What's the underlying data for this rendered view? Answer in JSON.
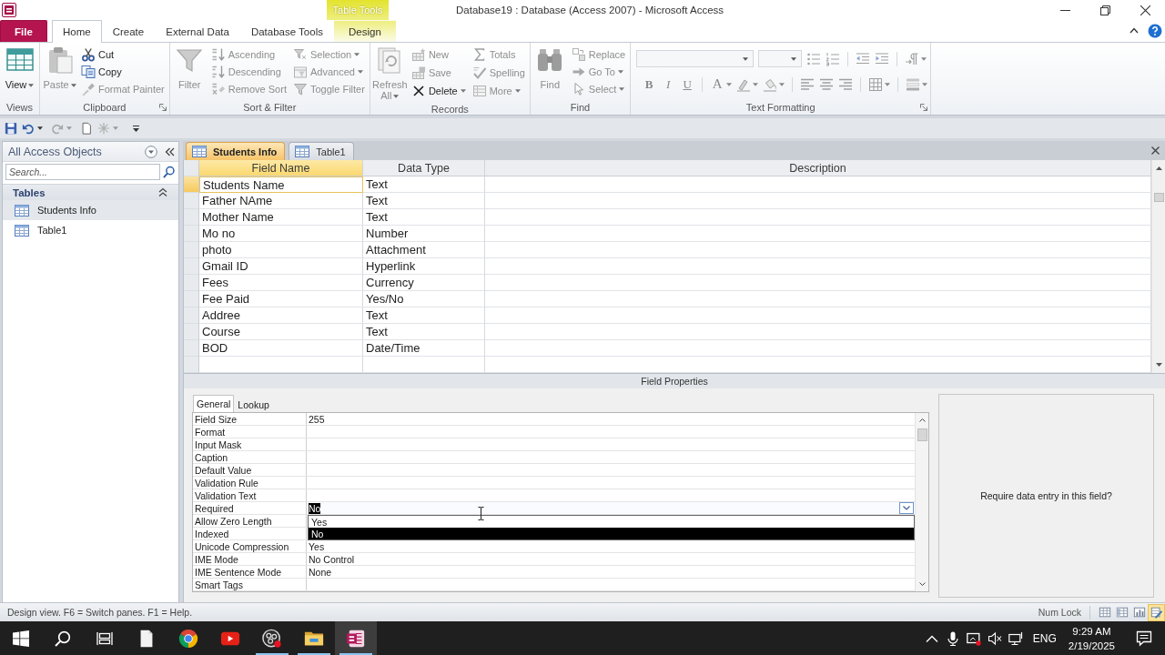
{
  "title_bar": {
    "contextual_group": "Table Tools",
    "title": "Database19 : Database (Access 2007) - Microsoft Access"
  },
  "ribbon_tabs": [
    {
      "label": "File",
      "kind": "backstage",
      "selected": false
    },
    {
      "label": "Home",
      "kind": "standard",
      "selected": true
    },
    {
      "label": "Create",
      "kind": "standard",
      "selected": false
    },
    {
      "label": "External Data",
      "kind": "standard",
      "selected": false
    },
    {
      "label": "Database Tools",
      "kind": "standard",
      "selected": false
    },
    {
      "label": "Design",
      "kind": "contextual",
      "selected": false
    }
  ],
  "ribbon_groups": [
    {
      "label": "Views",
      "kind": "commands",
      "launcher": false,
      "columns": [
        [
          {
            "label": "View",
            "kind": "large",
            "disabled": false,
            "dropdown": true
          }
        ]
      ]
    },
    {
      "label": "Clipboard",
      "kind": "commands",
      "launcher": true,
      "columns": [
        [
          {
            "label": "Paste",
            "kind": "large",
            "disabled": true,
            "dropdown": true
          }
        ],
        [
          {
            "label": "Cut",
            "kind": "small",
            "disabled": false,
            "dropdown": false
          },
          {
            "label": "Copy",
            "kind": "small",
            "disabled": false,
            "dropdown": false
          },
          {
            "label": "Format Painter",
            "kind": "small",
            "disabled": true,
            "dropdown": false
          }
        ]
      ]
    },
    {
      "label": "Sort & Filter",
      "kind": "commands",
      "launcher": false,
      "columns": [
        [
          {
            "label": "Filter",
            "kind": "large",
            "disabled": true,
            "dropdown": false
          }
        ],
        [
          {
            "label": "Ascending",
            "kind": "small",
            "disabled": true,
            "dropdown": false
          },
          {
            "label": "Descending",
            "kind": "small",
            "disabled": true,
            "dropdown": false
          },
          {
            "label": "Remove Sort",
            "kind": "small",
            "disabled": true,
            "dropdown": false
          }
        ],
        [
          {
            "label": "Selection",
            "kind": "small",
            "disabled": true,
            "dropdown": true
          },
          {
            "label": "Advanced",
            "kind": "small",
            "disabled": true,
            "dropdown": true
          },
          {
            "label": "Toggle Filter",
            "kind": "small",
            "disabled": true,
            "dropdown": false
          }
        ]
      ]
    },
    {
      "label": "Records",
      "kind": "commands",
      "launcher": false,
      "columns": [
        [
          {
            "label": "Refresh All",
            "kind": "large",
            "disabled": true,
            "dropdown": true
          }
        ],
        [
          {
            "label": "New",
            "kind": "small",
            "disabled": true,
            "dropdown": false
          },
          {
            "label": "Save",
            "kind": "small",
            "disabled": true,
            "dropdown": false
          },
          {
            "label": "Delete",
            "kind": "small",
            "disabled": false,
            "dropdown": true
          }
        ],
        [
          {
            "label": "Totals",
            "kind": "small",
            "disabled": true,
            "dropdown": false
          },
          {
            "label": "Spelling",
            "kind": "small",
            "disabled": true,
            "dropdown": false
          },
          {
            "label": "More",
            "kind": "small",
            "disabled": true,
            "dropdown": true
          }
        ]
      ]
    },
    {
      "label": "Find",
      "kind": "commands",
      "launcher": false,
      "columns": [
        [
          {
            "label": "Find",
            "kind": "large",
            "disabled": true,
            "dropdown": false
          }
        ],
        [
          {
            "label": "Replace",
            "kind": "small",
            "disabled": true,
            "dropdown": false
          },
          {
            "label": "Go To",
            "kind": "small",
            "disabled": true,
            "dropdown": true
          },
          {
            "label": "Select",
            "kind": "small",
            "disabled": true,
            "dropdown": true
          }
        ]
      ]
    },
    {
      "label": "Text Formatting",
      "kind": "formatting",
      "launcher": true,
      "disabled": true,
      "glyphs": [
        "B",
        "I",
        "U",
        "A"
      ]
    }
  ],
  "navigation_pane": {
    "title": "All Access Objects",
    "search": {
      "placeholder": "Search..."
    },
    "groups": [
      {
        "label": "Tables",
        "expanded": true,
        "items": [
          {
            "label": "Students Info",
            "selected": true
          },
          {
            "label": "Table1",
            "selected": false
          }
        ]
      }
    ]
  },
  "document_tabs": [
    {
      "label": "Students Info",
      "selected": true
    },
    {
      "label": "Table1",
      "selected": false
    }
  ],
  "design_grid": {
    "columns": [
      {
        "label": "Field Name",
        "selected": true
      },
      {
        "label": "Data Type",
        "selected": false
      },
      {
        "label": "Description",
        "selected": false
      }
    ],
    "rows": [
      {
        "field_name": "Students Name",
        "data_type": "Text",
        "selected": true
      },
      {
        "field_name": "Father NAme",
        "data_type": "Text",
        "selected": false
      },
      {
        "field_name": "Mother Name",
        "data_type": "Text",
        "selected": false
      },
      {
        "field_name": "Mo no",
        "data_type": "Number",
        "selected": false
      },
      {
        "field_name": "photo",
        "data_type": "Attachment",
        "selected": false
      },
      {
        "field_name": "Gmail ID",
        "data_type": "Hyperlink",
        "selected": false
      },
      {
        "field_name": "Fees",
        "data_type": "Currency",
        "selected": false
      },
      {
        "field_name": "Fee Paid",
        "data_type": "Yes/No",
        "selected": false
      },
      {
        "field_name": "Addree",
        "data_type": "Text",
        "selected": false
      },
      {
        "field_name": "Course",
        "data_type": "Text",
        "selected": false
      },
      {
        "field_name": "BOD",
        "data_type": "Date/Time",
        "selected": false
      }
    ]
  },
  "field_properties": {
    "title": "Field Properties",
    "tabs": [
      {
        "label": "General",
        "selected": true
      },
      {
        "label": "Lookup",
        "selected": false
      }
    ],
    "properties": [
      {
        "name": "Field Size",
        "value": "255",
        "selected": false
      },
      {
        "name": "Format",
        "selected": false
      },
      {
        "name": "Input Mask",
        "selected": false
      },
      {
        "name": "Caption",
        "selected": false
      },
      {
        "name": "Default Value",
        "selected": false
      },
      {
        "name": "Validation Rule",
        "selected": false
      },
      {
        "name": "Validation Text",
        "selected": false
      },
      {
        "name": "Required",
        "value": "No",
        "selected": true
      },
      {
        "name": "Allow Zero Length",
        "selected": false
      },
      {
        "name": "Indexed",
        "selected": false
      },
      {
        "name": "Unicode Compression",
        "value": "Yes",
        "selected": false
      },
      {
        "name": "IME Mode",
        "value": "No Control",
        "selected": false
      },
      {
        "name": "IME Sentence Mode",
        "value": "None",
        "selected": false
      },
      {
        "name": "Smart Tags",
        "selected": false
      }
    ],
    "dropdown_options": [
      {
        "label": "Yes",
        "selected": false
      },
      {
        "label": "No",
        "selected": true
      }
    ],
    "help_text": "Require data entry in this field?"
  },
  "status_bar": {
    "text": "Design view. F6 = Switch panes. F1 = Help.",
    "indicator": "Num Lock",
    "views": [
      {
        "selected": false
      },
      {
        "selected": false
      },
      {
        "selected": false
      },
      {
        "selected": true
      }
    ]
  },
  "taskbar": {
    "apps": [
      {
        "running": false,
        "selected": false
      },
      {
        "running": false,
        "selected": false
      },
      {
        "running": false,
        "selected": false
      },
      {
        "running": true,
        "selected": false
      },
      {
        "running": true,
        "selected": false
      },
      {
        "running": true,
        "selected": true
      }
    ],
    "language": "ENG",
    "time": "9:29 AM",
    "date": "2/19/2025"
  }
}
